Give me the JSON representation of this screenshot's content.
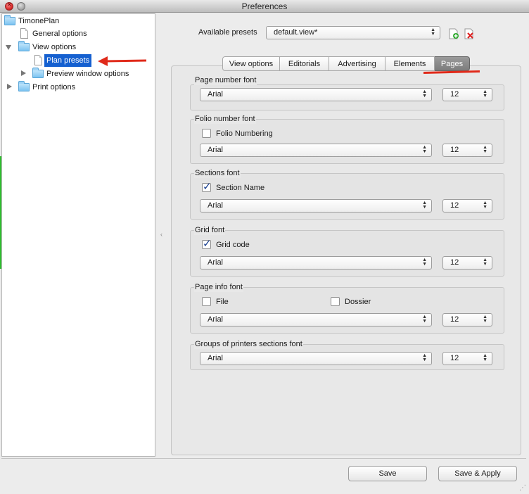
{
  "window": {
    "title": "Preferences"
  },
  "tree": {
    "root": {
      "label": "TimonePlan"
    },
    "general": {
      "label": "General options"
    },
    "view": {
      "label": "View options"
    },
    "plan_presets": {
      "label": "Plan presets"
    },
    "preview": {
      "label": "Preview window options"
    },
    "print": {
      "label": "Print options"
    }
  },
  "presets": {
    "label": "Available presets",
    "value": "default.view*"
  },
  "tabs": {
    "view_options": "View options",
    "editorials": "Editorials",
    "advertising": "Advertising",
    "elements": "Elements",
    "pages": "Pages",
    "active": "Pages"
  },
  "groups": {
    "page_number": {
      "title": "Page number font",
      "font": "Arial",
      "size": "12"
    },
    "folio_number": {
      "title": "Folio number font",
      "checkbox_label": "Folio Numbering",
      "checked": false,
      "font": "Arial",
      "size": "12"
    },
    "sections": {
      "title": "Sections font",
      "checkbox_label": "Section Name",
      "checked": true,
      "font": "Arial",
      "size": "12"
    },
    "grid": {
      "title": "Grid font",
      "checkbox_label": "Grid code",
      "checked": true,
      "font": "Arial",
      "size": "12"
    },
    "page_info": {
      "title": "Page info font",
      "file_label": "File",
      "file_checked": false,
      "dossier_label": "Dossier",
      "dossier_checked": false,
      "font": "Arial",
      "size": "12"
    },
    "printers_sections": {
      "title": "Groups of printers sections font",
      "font": "Arial",
      "size": "12"
    }
  },
  "buttons": {
    "save": "Save",
    "save_apply": "Save & Apply"
  },
  "colors": {
    "selection": "#1560d0",
    "annotation_red": "#e02a1a",
    "active_tab": "#8a8a8a"
  }
}
